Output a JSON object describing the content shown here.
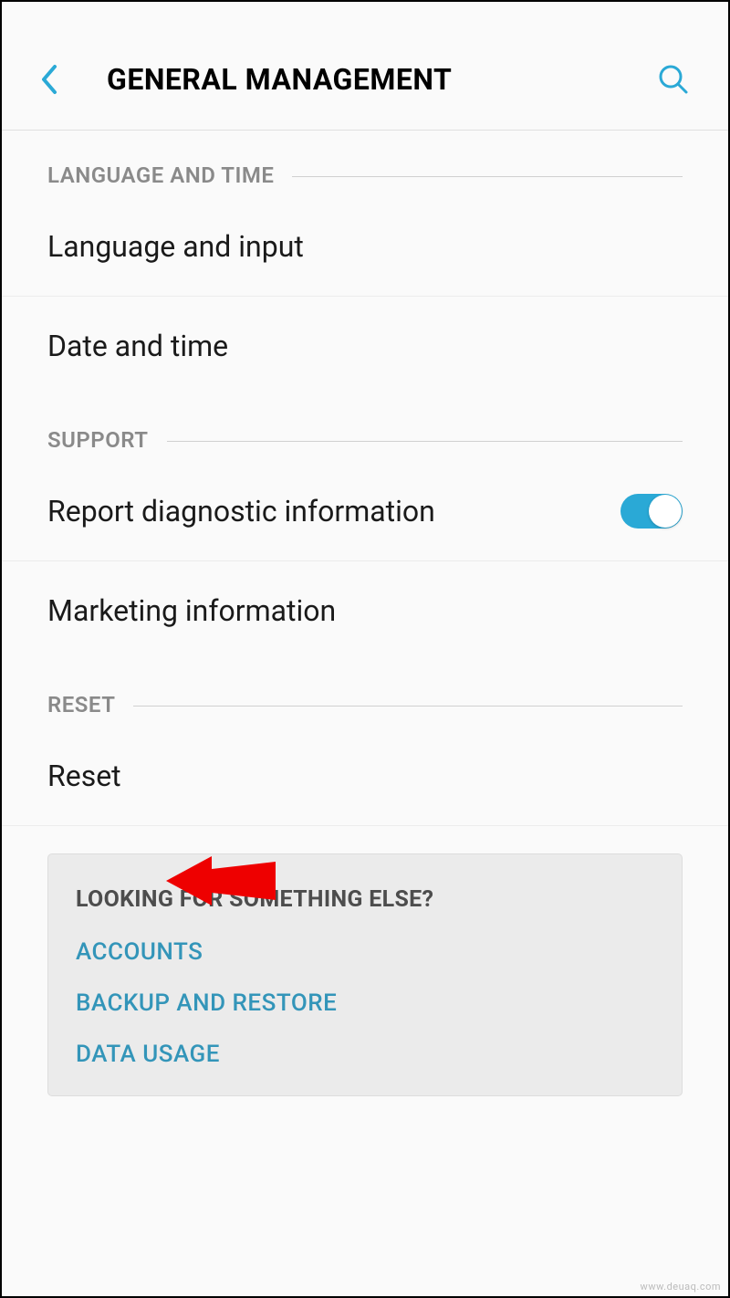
{
  "header": {
    "title": "GENERAL MANAGEMENT"
  },
  "sections": {
    "language_time": {
      "header": "LANGUAGE AND TIME",
      "items": {
        "language_input": "Language and input",
        "date_time": "Date and time"
      }
    },
    "support": {
      "header": "SUPPORT",
      "items": {
        "report_diagnostic": "Report diagnostic information",
        "marketing_info": "Marketing information"
      }
    },
    "reset": {
      "header": "RESET",
      "items": {
        "reset": "Reset"
      }
    }
  },
  "footer": {
    "title": "LOOKING FOR SOMETHING ELSE?",
    "links": {
      "accounts": "ACCOUNTS",
      "backup_restore": "BACKUP AND RESTORE",
      "data_usage": "DATA USAGE"
    }
  },
  "colors": {
    "accent": "#2aa9d6",
    "link": "#3395b9"
  },
  "watermark": "www.deuaq.com"
}
